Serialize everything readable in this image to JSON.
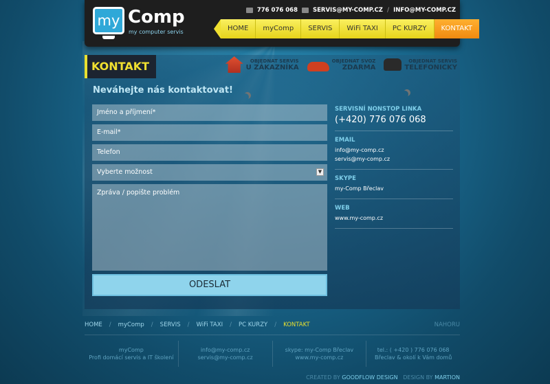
{
  "header": {
    "logo_word1": "my",
    "logo_word2": "Comp",
    "logo_sub": "my computer servis",
    "phone": "776 076 068",
    "email1": "SERVIS@MY-COMP.CZ",
    "email2": "INFO@MY-COMP.CZ"
  },
  "nav": [
    "HOME",
    "myComp",
    "SERVIS",
    "WiFi TAXI",
    "PC KURZY",
    "KONTAKT"
  ],
  "page": {
    "title": "KONTAKT",
    "subtitle": "Neváhejte nás kontaktovat!"
  },
  "orders": [
    {
      "small": "OBJEDNAT SERVIS",
      "big": "U ZÁKAZNÍKA",
      "icon": "house-icon"
    },
    {
      "small": "OBJEDNAT SVOZ",
      "big": "ZDARMA",
      "icon": "car-icon"
    },
    {
      "small": "OBJEDNAT SERVIS",
      "big": "TELEFONICKY",
      "icon": "telephone-icon"
    }
  ],
  "form": {
    "name_placeholder": "Jméno a příjmení*",
    "email_placeholder": "E-mail*",
    "phone_placeholder": "Telefon",
    "select_value": "Vyberte možnost",
    "message_placeholder": "Zpráva / popište problém",
    "submit": "ODESLAT"
  },
  "info": {
    "hotline_label": "SERVISNÍ NONSTOP LINKA",
    "hotline": "(+420) 776 076 068",
    "email_label": "EMAIL",
    "email1": "info@my-comp.cz",
    "email2": "servis@my-comp.cz",
    "skype_label": "SKYPE",
    "skype": "my-Comp Břeclav",
    "web_label": "WEB",
    "web": "www.my-comp.cz"
  },
  "footer": {
    "nav": [
      "HOME",
      "myComp",
      "SERVIS",
      "WiFi TAXI",
      "PC KURZY",
      "KONTAKT"
    ],
    "nahoru": "NAHORU",
    "col1_line1": "myComp",
    "col1_line2": "Profi domácí servis a IT školení",
    "col2_line1": "info@my-comp.cz",
    "col2_line2": "servis@my-comp.cz",
    "col3_line1": "skype: my-Comp Břeclav",
    "col3_line2": "www.my-comp.cz",
    "col4_line1": "tel.: ( +420 ) 776 076 068",
    "col4_line2": "Břeclav & okolí k Vám domů",
    "created_by_label": "CREATED BY",
    "created_by": "GOODFLOW DESIGN",
    "design_by_label": "DESIGN BY",
    "design_by": "MARTION"
  },
  "colors": {
    "accent_yellow": "#e8e030",
    "nav_active": "#f08a10",
    "submit_bg": "#8fd4ec"
  }
}
